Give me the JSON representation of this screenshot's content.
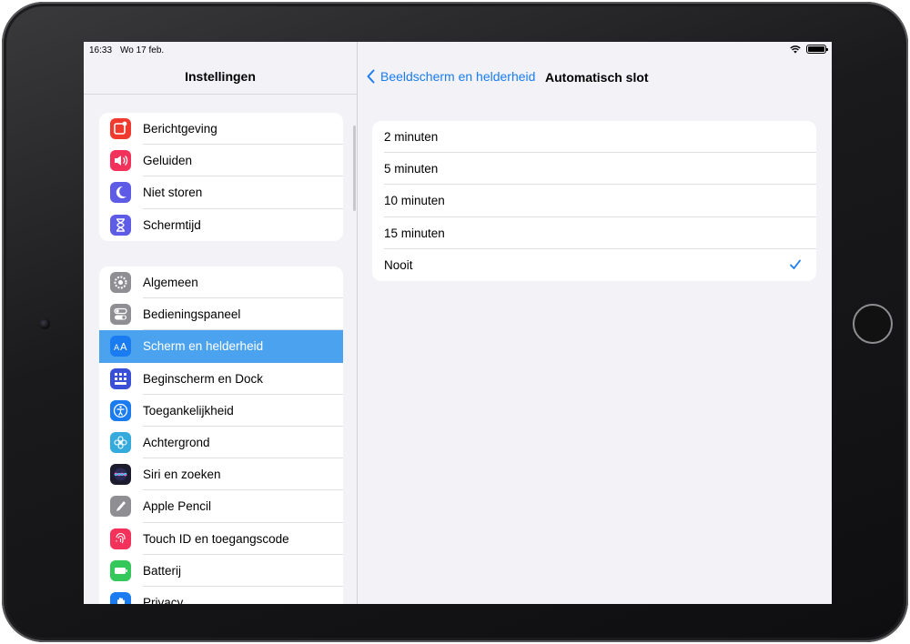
{
  "status_bar": {
    "time": "16:33",
    "date": "Wo 17 feb."
  },
  "master": {
    "title": "Instellingen",
    "group1": [
      {
        "label": "Berichtgeving",
        "icon": "notifications-icon",
        "color": "#f03a2e"
      },
      {
        "label": "Geluiden",
        "icon": "sounds-icon",
        "color": "#f2325a"
      },
      {
        "label": "Niet storen",
        "icon": "moon-icon",
        "color": "#5e5ce6"
      },
      {
        "label": "Schermtijd",
        "icon": "hourglass-icon",
        "color": "#5e5ce6"
      }
    ],
    "group2": [
      {
        "label": "Algemeen",
        "icon": "gear-icon",
        "color": "#8e8e93"
      },
      {
        "label": "Bedieningspaneel",
        "icon": "toggles-icon",
        "color": "#8e8e93"
      },
      {
        "label": "Scherm en helderheid",
        "icon": "text-size-icon",
        "color": "#1a7cf0",
        "selected": true
      },
      {
        "label": "Beginscherm en Dock",
        "icon": "home-grid-icon",
        "color": "#3a4fd8"
      },
      {
        "label": "Toegankelijkheid",
        "icon": "accessibility-icon",
        "color": "#1a7cf0"
      },
      {
        "label": "Achtergrond",
        "icon": "flower-icon",
        "color": "#35aadc"
      },
      {
        "label": "Siri en zoeken",
        "icon": "siri-icon",
        "color": "#1c1c2e"
      },
      {
        "label": "Apple Pencil",
        "icon": "pencil-icon",
        "color": "#8e8e93"
      },
      {
        "label": "Touch ID en toegangscode",
        "icon": "fingerprint-icon",
        "color": "#f2325a"
      },
      {
        "label": "Batterij",
        "icon": "battery-icon",
        "color": "#34c759"
      },
      {
        "label": "Privacy",
        "icon": "hand-icon",
        "color": "#1a7cf0"
      }
    ]
  },
  "detail": {
    "back_label": "Beeldscherm en helderheid",
    "title": "Automatisch slot",
    "options": [
      {
        "label": "2 minuten",
        "checked": false
      },
      {
        "label": "5 minuten",
        "checked": false
      },
      {
        "label": "10 minuten",
        "checked": false
      },
      {
        "label": "15 minuten",
        "checked": false
      },
      {
        "label": "Nooit",
        "checked": true
      }
    ]
  },
  "colors": {
    "accent": "#1a7cf0",
    "selected_row": "#4ba3f0"
  }
}
